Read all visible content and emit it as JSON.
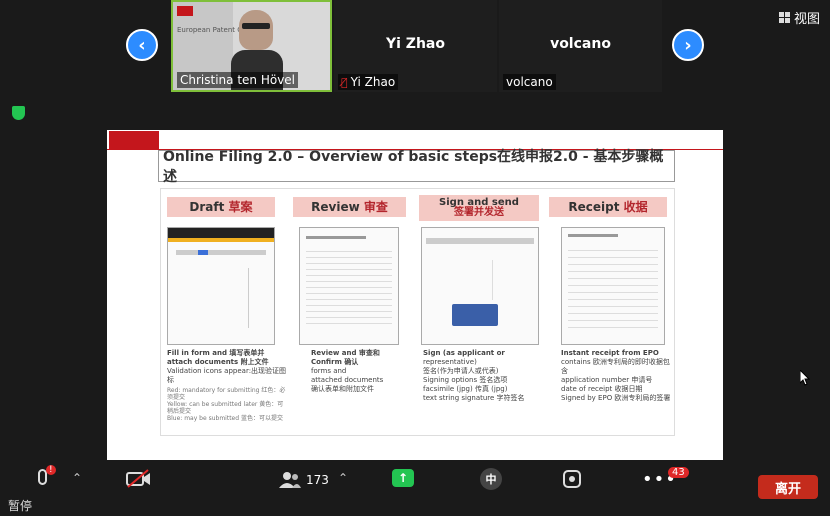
{
  "window": {
    "view_label": "视图"
  },
  "participants": [
    {
      "name": "Christina ten Hövel",
      "video": true,
      "muted": false,
      "bg_text": "European Patent Office"
    },
    {
      "name": "Yi Zhao",
      "display": "Yi Zhao",
      "video": false,
      "muted": true
    },
    {
      "name": "volcano",
      "display": "volcano",
      "video": false,
      "muted": false
    }
  ],
  "slide": {
    "title": "Online Filing 2.0 – Overview of basic steps在线申报2.0 - 基本步骤概述",
    "steps": [
      {
        "label": "Draft",
        "label_cn": "草案",
        "desc": [
          "Fill in form and 填写表单并",
          "attach documents 附上文件",
          "Validation icons appear:出现验证图标"
        ],
        "legend": [
          "Red: mandatory for submitting 红色：必须提交",
          "Yellow: can be submitted later 黄色：可稍后提交",
          "Blue: may be submitted 蓝色：可以提交"
        ]
      },
      {
        "label": "Review",
        "label_cn": "审查",
        "desc": [
          "Review and 审查和",
          "Confirm 确认",
          "forms and",
          "attached documents",
          "确认表单和附加文件"
        ]
      },
      {
        "label": "Sign and send",
        "label_cn": "签署并发送",
        "desc": [
          "Sign (as applicant or",
          "representative)",
          "签名(作为申请人或代表)",
          "Signing options 签名选项",
          "facsimile (jpg) 传真 (jpg)",
          "text string signature 字符签名"
        ]
      },
      {
        "label": "Receipt",
        "label_cn": "收据",
        "desc": [
          "Instant receipt from EPO",
          "contains 欧洲专利局的即时收据包含",
          "application number 申请号",
          "date of receipt 收据日期",
          "Signed by EPO 欧洲专利局的签署"
        ]
      }
    ]
  },
  "toolbar": {
    "participants_count": "173",
    "more_badge": "43",
    "interpret_label": "中",
    "leave_label": "离开"
  },
  "status_text": "暂停"
}
